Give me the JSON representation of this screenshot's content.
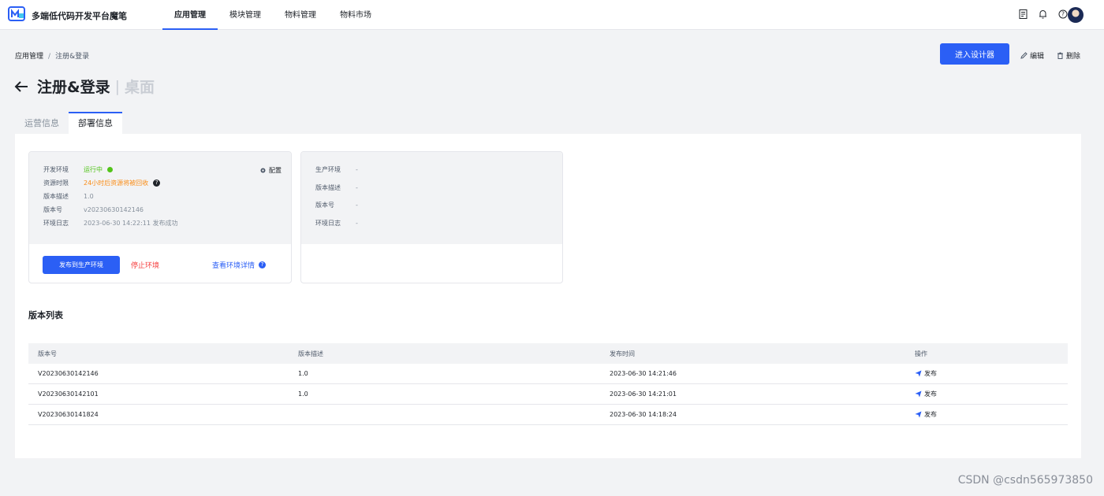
{
  "app": {
    "brand": "多端低代码开发平台魔笔"
  },
  "nav": {
    "items": [
      {
        "label": "应用管理",
        "active": true
      },
      {
        "label": "模块管理",
        "active": false
      },
      {
        "label": "物料管理",
        "active": false
      },
      {
        "label": "物料市场",
        "active": false
      }
    ]
  },
  "top_icons": [
    "document-icon",
    "bell-icon",
    "help-icon"
  ],
  "breadcrumb": {
    "root": "应用管理",
    "sep": "/",
    "current": "注册&登录"
  },
  "header_actions": {
    "design_label": "进入设计器",
    "edit_label": "编辑",
    "delete_label": "删除"
  },
  "page": {
    "title": "注册&登录",
    "divider": "|",
    "subtitle": "桌面"
  },
  "tabs": [
    {
      "label": "运营信息",
      "active": false
    },
    {
      "label": "部署信息",
      "active": true
    }
  ],
  "dev_env": {
    "config_label": "配置",
    "rows": [
      {
        "key": "开发环境",
        "value": "运行中"
      },
      {
        "key": "资源时限",
        "value": "24小时后资源将被回收"
      },
      {
        "key": "版本描述",
        "value": "1.0"
      },
      {
        "key": "版本号",
        "value": "v20230630142146"
      },
      {
        "key": "环境日志",
        "value": "2023-06-30 14:22:11 发布成功"
      }
    ],
    "publish_label": "发布到生产环境",
    "stop_label": "停止环境",
    "detail_label": "查看环境详情",
    "help_glyph": "?"
  },
  "prod_env": {
    "rows": [
      {
        "key": "生产环境",
        "value": "-"
      },
      {
        "key": "版本描述",
        "value": "-"
      },
      {
        "key": "版本号",
        "value": "-"
      },
      {
        "key": "环境日志",
        "value": "-"
      }
    ]
  },
  "versions": {
    "title": "版本列表",
    "columns": [
      "版本号",
      "版本描述",
      "发布时间",
      "操作"
    ],
    "rows": [
      {
        "version": "V20230630142146",
        "desc": "1.0",
        "time": "2023-06-30 14:21:46",
        "action": "发布"
      },
      {
        "version": "V20230630142101",
        "desc": "1.0",
        "time": "2023-06-30 14:21:01",
        "action": "发布"
      },
      {
        "version": "V20230630141824",
        "desc": "",
        "time": "2023-06-30 14:18:24",
        "action": "发布"
      }
    ]
  },
  "watermark": "CSDN @csdn565973850",
  "colors": {
    "primary": "#2b5ff5",
    "success": "#52c41a",
    "warning": "#fa8c16",
    "danger": "#f53f3f"
  }
}
